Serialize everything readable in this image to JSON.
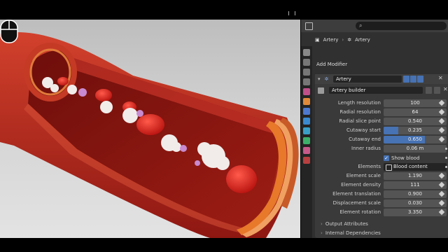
{
  "breadcrumb": {
    "object": "Artery",
    "modifier_object": "Artery"
  },
  "panel": {
    "add_modifier": "Add Modifier",
    "modifier_name": "Artery",
    "node_group": "Artery builder"
  },
  "params": {
    "length_resolution": {
      "label": "Length resolution",
      "value": "100"
    },
    "radial_resolution": {
      "label": "Radial resolution",
      "value": "64"
    },
    "radial_slice_point": {
      "label": "Radial slice point",
      "value": "0.540"
    },
    "cutaway_start": {
      "label": "Cutaway start",
      "value": "0.235",
      "fill": 0.235
    },
    "cutaway_end": {
      "label": "Cutaway end",
      "value": "0.650",
      "fill": 0.65
    },
    "inner_radius": {
      "label": "Inner radius",
      "value": "0.06 m"
    },
    "show_blood": {
      "label": "Show blood",
      "checked": true
    },
    "elements": {
      "label": "Elements",
      "value": "Blood content"
    },
    "element_scale": {
      "label": "Element scale",
      "value": "1.190"
    },
    "element_density": {
      "label": "Element density",
      "value": "111"
    },
    "element_translation": {
      "label": "Element translation",
      "value": "0.900"
    },
    "displacement_scale": {
      "label": "Displacement scale",
      "value": "0.030"
    },
    "element_rotation": {
      "label": "Element rotation",
      "value": "3.350"
    }
  },
  "subpanels": {
    "output_attributes": "Output Attributes",
    "internal_dependencies": "Internal Dependencies"
  },
  "colors": {
    "accent": "#4772b3",
    "panel_bg": "#303030",
    "artery_red": "#b3201a",
    "orange": "#e8782a"
  },
  "icons": [
    "editor-type-icon",
    "search-icon",
    "object-icon",
    "wrench-icon",
    "node-group-icon",
    "mouse-icon"
  ]
}
